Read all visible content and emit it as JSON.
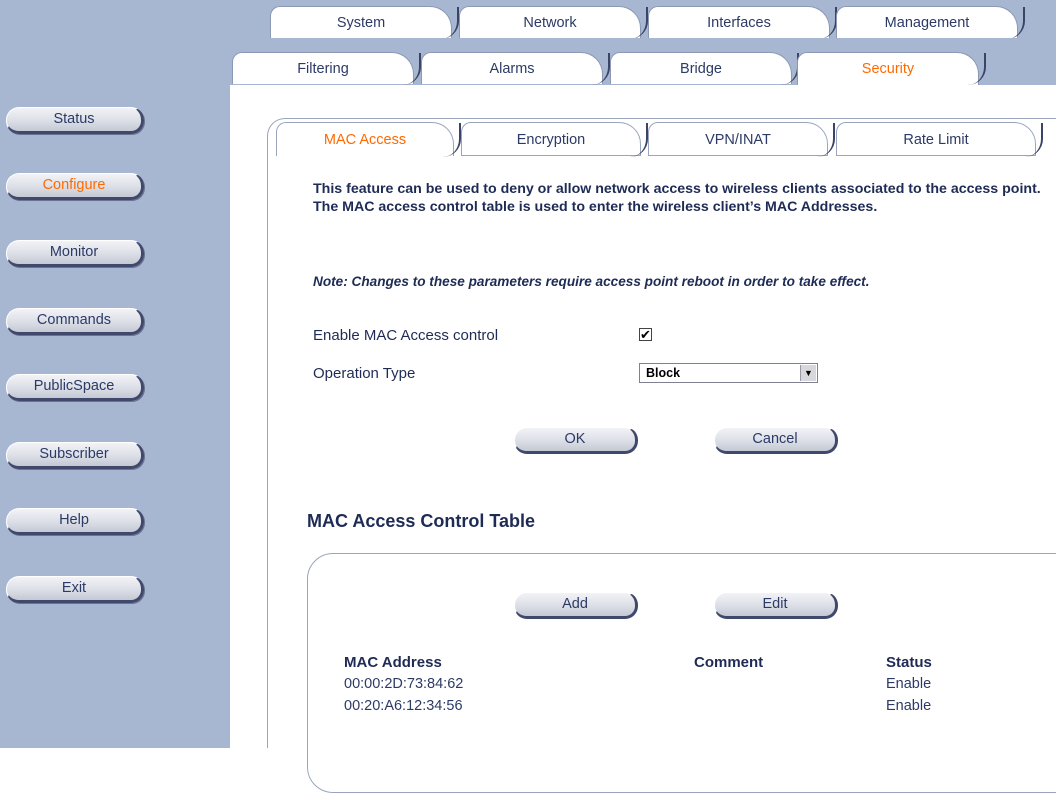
{
  "top_tabs": [
    "System",
    "Network",
    "Interfaces",
    "Management"
  ],
  "second_tabs": [
    "Filtering",
    "Alarms",
    "Bridge",
    "Security"
  ],
  "second_tabs_active": "Security",
  "nav": {
    "items": [
      "Status",
      "Configure",
      "Monitor",
      "Commands",
      "PublicSpace",
      "Subscriber",
      "Help",
      "Exit"
    ],
    "active": "Configure"
  },
  "sub_tabs": [
    "MAC Access",
    "Encryption",
    "VPN/INAT",
    "Rate Limit"
  ],
  "sub_tabs_active": "MAC Access",
  "description": "This feature can be used to deny or allow network access to wireless clients associated to the access point. The MAC access control table is used to enter the wireless client’s MAC Addresses.",
  "note": "Note: Changes to these parameters require access point reboot in order to take effect.",
  "form": {
    "enable_label": "Enable MAC Access control",
    "enable_checked": true,
    "check_mark": "✔",
    "operation_label": "Operation Type",
    "operation_value": "Block",
    "ok_label": "OK",
    "cancel_label": "Cancel"
  },
  "table": {
    "title": "MAC Access Control Table",
    "add_label": "Add",
    "edit_label": "Edit",
    "columns": [
      "MAC Address",
      "Comment",
      "Status"
    ],
    "rows": [
      {
        "mac": "00:00:2D:73:84:62",
        "comment": "",
        "status": "Enable"
      },
      {
        "mac": "00:20:A6:12:34:56",
        "comment": "",
        "status": "Enable"
      }
    ]
  },
  "colors": {
    "nav_bg": "#a8b7d1",
    "active_text": "#ff6a00",
    "text": "#1e2b55"
  }
}
